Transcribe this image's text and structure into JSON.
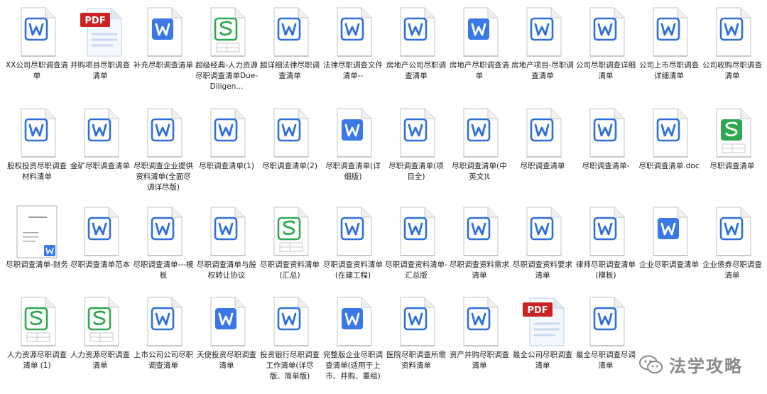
{
  "colors": {
    "word_blue": "#2f6fdc",
    "word_blue_solid": "#3a78e6",
    "sheet_green": "#2fa84f",
    "pdf_red": "#cc2222",
    "label_text": "#222222",
    "watermark_gray": "#8a8a8a"
  },
  "watermark": {
    "text": "法学攻略",
    "icon": "wechat-icon"
  },
  "files": [
    {
      "label": "XX公司尽职调查清单",
      "type": "word"
    },
    {
      "label": "并购项目尽职调查清单",
      "type": "pdf"
    },
    {
      "label": "补充尽职调查清单",
      "type": "word-solid"
    },
    {
      "label": "超级经典-人力资源尽职调查清单Due-Diligen...",
      "type": "sheet"
    },
    {
      "label": "超详细法律尽职调查清单",
      "type": "word"
    },
    {
      "label": "法律尽职调查文件清单--",
      "type": "word"
    },
    {
      "label": "房地产公司尽职调查清单",
      "type": "word"
    },
    {
      "label": "房地产尽职调查清单",
      "type": "word-solid"
    },
    {
      "label": "房地产项目-尽职调查清单",
      "type": "word"
    },
    {
      "label": "公司尽职调查详细清单",
      "type": "word"
    },
    {
      "label": "公司上市尽职调查详细清单",
      "type": "word"
    },
    {
      "label": "公司收购尽职调查清单",
      "type": "word"
    },
    {
      "label": "股权投资尽职调查材料清单",
      "type": "word"
    },
    {
      "label": "金矿尽职调查清单",
      "type": "word"
    },
    {
      "label": "尽职调查企业提供资料清单(全面尽调详尽版)",
      "type": "word"
    },
    {
      "label": "尽职调查清单(1)",
      "type": "word"
    },
    {
      "label": "尽职调查清单(2)",
      "type": "word"
    },
    {
      "label": "尽职调查清单(详细版)",
      "type": "word-solid"
    },
    {
      "label": "尽职调查清单(项目全)",
      "type": "word"
    },
    {
      "label": "尽职调查清单(中英文)t",
      "type": "word"
    },
    {
      "label": "尽职调查清单",
      "type": "word"
    },
    {
      "label": "尽职调查清单-",
      "type": "word"
    },
    {
      "label": "尽职调查清单.doc",
      "type": "word"
    },
    {
      "label": "尽职调查清单",
      "type": "sheet-solid"
    },
    {
      "label": "尽职调查清单-财务",
      "type": "thumb"
    },
    {
      "label": "尽职调查清单范本",
      "type": "word"
    },
    {
      "label": "尽职调查清单---模板",
      "type": "word"
    },
    {
      "label": "尽职调查清单与股权转让协议",
      "type": "word"
    },
    {
      "label": "尽职调查资料清单(汇总)",
      "type": "sheet"
    },
    {
      "label": "尽职调查资料清单(在建工程)",
      "type": "word"
    },
    {
      "label": "尽职调查资料清单-汇总版",
      "type": "word"
    },
    {
      "label": "尽职调查资料需求清单",
      "type": "word"
    },
    {
      "label": "尽职调查资料要求清单",
      "type": "word"
    },
    {
      "label": "律师尽职调查清单(模板)",
      "type": "word"
    },
    {
      "label": "企业尽职调查清单",
      "type": "word-solid"
    },
    {
      "label": "企业债券尽职调查清单",
      "type": "word"
    },
    {
      "label": "人力资源尽职调查清单 (1)",
      "type": "sheet"
    },
    {
      "label": "人力资源尽职调查清单",
      "type": "sheet"
    },
    {
      "label": "上市公司公司尽职调查清单",
      "type": "word"
    },
    {
      "label": "天使投资尽职调查清单",
      "type": "word-solid"
    },
    {
      "label": "投资银行尽职调查工作清单(详尽版、简单版)",
      "type": "word"
    },
    {
      "label": "完整版企业尽职调查清单(适用于上市、并购、重组)",
      "type": "word-solid"
    },
    {
      "label": "医院尽职调查所需资料清单",
      "type": "word"
    },
    {
      "label": "资产并购尽职调查清单",
      "type": "word"
    },
    {
      "label": "最全公司尽职调查清单",
      "type": "pdf"
    },
    {
      "label": "最全尽职调查尽调清单",
      "type": "word"
    }
  ]
}
